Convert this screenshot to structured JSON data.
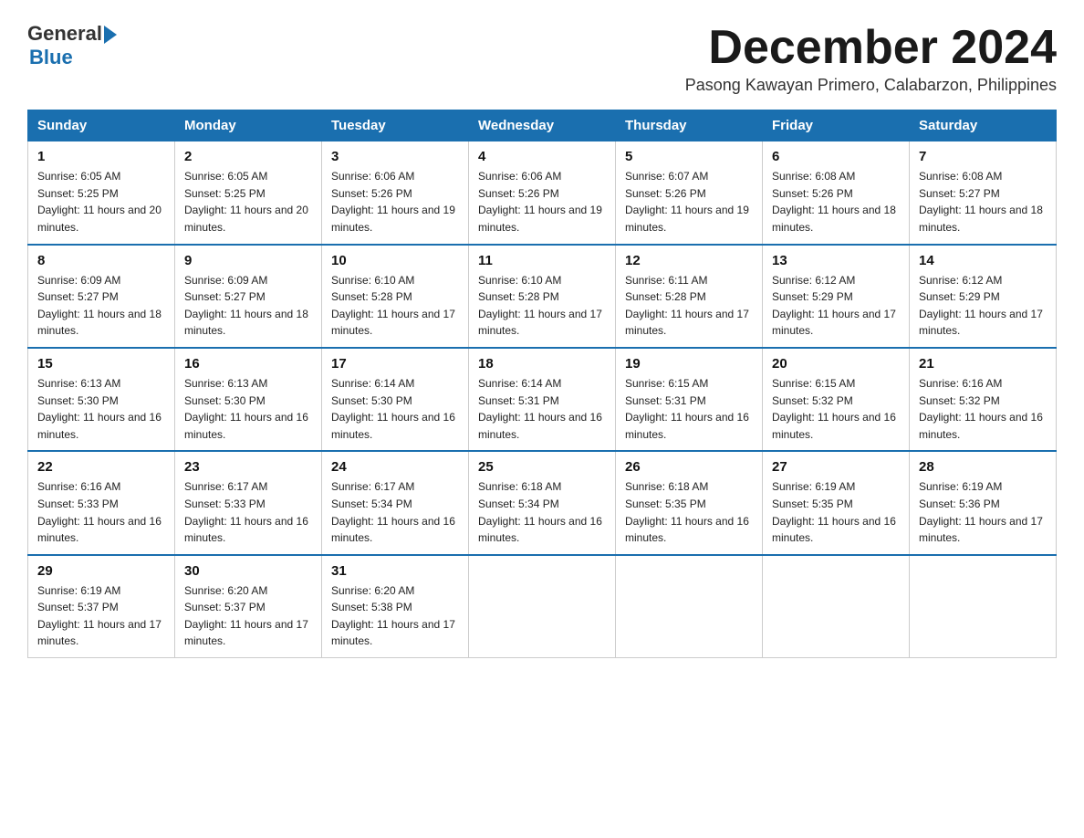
{
  "logo": {
    "text_general": "General",
    "text_blue": "Blue",
    "alt": "GeneralBlue logo"
  },
  "title": {
    "month_year": "December 2024",
    "location": "Pasong Kawayan Primero, Calabarzon, Philippines"
  },
  "header": {
    "days": [
      "Sunday",
      "Monday",
      "Tuesday",
      "Wednesday",
      "Thursday",
      "Friday",
      "Saturday"
    ]
  },
  "weeks": [
    [
      {
        "day": "1",
        "sunrise": "6:05 AM",
        "sunset": "5:25 PM",
        "daylight": "11 hours and 20 minutes."
      },
      {
        "day": "2",
        "sunrise": "6:05 AM",
        "sunset": "5:25 PM",
        "daylight": "11 hours and 20 minutes."
      },
      {
        "day": "3",
        "sunrise": "6:06 AM",
        "sunset": "5:26 PM",
        "daylight": "11 hours and 19 minutes."
      },
      {
        "day": "4",
        "sunrise": "6:06 AM",
        "sunset": "5:26 PM",
        "daylight": "11 hours and 19 minutes."
      },
      {
        "day": "5",
        "sunrise": "6:07 AM",
        "sunset": "5:26 PM",
        "daylight": "11 hours and 19 minutes."
      },
      {
        "day": "6",
        "sunrise": "6:08 AM",
        "sunset": "5:26 PM",
        "daylight": "11 hours and 18 minutes."
      },
      {
        "day": "7",
        "sunrise": "6:08 AM",
        "sunset": "5:27 PM",
        "daylight": "11 hours and 18 minutes."
      }
    ],
    [
      {
        "day": "8",
        "sunrise": "6:09 AM",
        "sunset": "5:27 PM",
        "daylight": "11 hours and 18 minutes."
      },
      {
        "day": "9",
        "sunrise": "6:09 AM",
        "sunset": "5:27 PM",
        "daylight": "11 hours and 18 minutes."
      },
      {
        "day": "10",
        "sunrise": "6:10 AM",
        "sunset": "5:28 PM",
        "daylight": "11 hours and 17 minutes."
      },
      {
        "day": "11",
        "sunrise": "6:10 AM",
        "sunset": "5:28 PM",
        "daylight": "11 hours and 17 minutes."
      },
      {
        "day": "12",
        "sunrise": "6:11 AM",
        "sunset": "5:28 PM",
        "daylight": "11 hours and 17 minutes."
      },
      {
        "day": "13",
        "sunrise": "6:12 AM",
        "sunset": "5:29 PM",
        "daylight": "11 hours and 17 minutes."
      },
      {
        "day": "14",
        "sunrise": "6:12 AM",
        "sunset": "5:29 PM",
        "daylight": "11 hours and 17 minutes."
      }
    ],
    [
      {
        "day": "15",
        "sunrise": "6:13 AM",
        "sunset": "5:30 PM",
        "daylight": "11 hours and 16 minutes."
      },
      {
        "day": "16",
        "sunrise": "6:13 AM",
        "sunset": "5:30 PM",
        "daylight": "11 hours and 16 minutes."
      },
      {
        "day": "17",
        "sunrise": "6:14 AM",
        "sunset": "5:30 PM",
        "daylight": "11 hours and 16 minutes."
      },
      {
        "day": "18",
        "sunrise": "6:14 AM",
        "sunset": "5:31 PM",
        "daylight": "11 hours and 16 minutes."
      },
      {
        "day": "19",
        "sunrise": "6:15 AM",
        "sunset": "5:31 PM",
        "daylight": "11 hours and 16 minutes."
      },
      {
        "day": "20",
        "sunrise": "6:15 AM",
        "sunset": "5:32 PM",
        "daylight": "11 hours and 16 minutes."
      },
      {
        "day": "21",
        "sunrise": "6:16 AM",
        "sunset": "5:32 PM",
        "daylight": "11 hours and 16 minutes."
      }
    ],
    [
      {
        "day": "22",
        "sunrise": "6:16 AM",
        "sunset": "5:33 PM",
        "daylight": "11 hours and 16 minutes."
      },
      {
        "day": "23",
        "sunrise": "6:17 AM",
        "sunset": "5:33 PM",
        "daylight": "11 hours and 16 minutes."
      },
      {
        "day": "24",
        "sunrise": "6:17 AM",
        "sunset": "5:34 PM",
        "daylight": "11 hours and 16 minutes."
      },
      {
        "day": "25",
        "sunrise": "6:18 AM",
        "sunset": "5:34 PM",
        "daylight": "11 hours and 16 minutes."
      },
      {
        "day": "26",
        "sunrise": "6:18 AM",
        "sunset": "5:35 PM",
        "daylight": "11 hours and 16 minutes."
      },
      {
        "day": "27",
        "sunrise": "6:19 AM",
        "sunset": "5:35 PM",
        "daylight": "11 hours and 16 minutes."
      },
      {
        "day": "28",
        "sunrise": "6:19 AM",
        "sunset": "5:36 PM",
        "daylight": "11 hours and 17 minutes."
      }
    ],
    [
      {
        "day": "29",
        "sunrise": "6:19 AM",
        "sunset": "5:37 PM",
        "daylight": "11 hours and 17 minutes."
      },
      {
        "day": "30",
        "sunrise": "6:20 AM",
        "sunset": "5:37 PM",
        "daylight": "11 hours and 17 minutes."
      },
      {
        "day": "31",
        "sunrise": "6:20 AM",
        "sunset": "5:38 PM",
        "daylight": "11 hours and 17 minutes."
      },
      null,
      null,
      null,
      null
    ]
  ]
}
